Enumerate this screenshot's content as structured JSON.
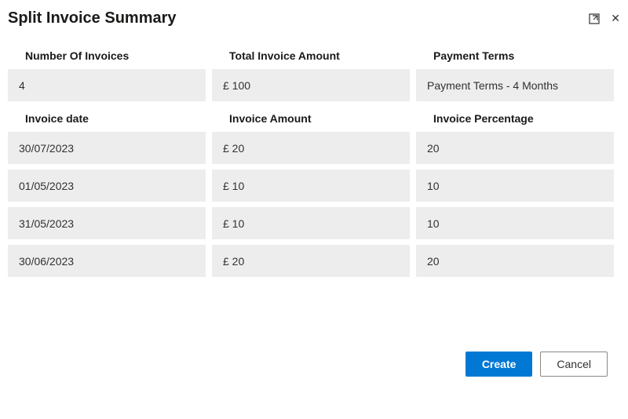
{
  "header": {
    "title": "Split Invoice Summary"
  },
  "labels": {
    "numberOfInvoices": "Number Of Invoices",
    "totalInvoiceAmount": "Total Invoice Amount",
    "paymentTerms": "Payment Terms",
    "invoiceDate": "Invoice date",
    "invoiceAmount": "Invoice Amount",
    "invoicePercentage": "Invoice Percentage"
  },
  "summary": {
    "numberOfInvoices": "4",
    "totalInvoiceAmount": "£ 100",
    "paymentTerms": "Payment Terms - 4 Months"
  },
  "rows": [
    {
      "date": "30/07/2023",
      "amount": "£ 20",
      "percentage": "20"
    },
    {
      "date": "01/05/2023",
      "amount": "£ 10",
      "percentage": "10"
    },
    {
      "date": "31/05/2023",
      "amount": "£ 10",
      "percentage": "10"
    },
    {
      "date": "30/06/2023",
      "amount": "£ 20",
      "percentage": "20"
    }
  ],
  "footer": {
    "create": "Create",
    "cancel": "Cancel"
  }
}
